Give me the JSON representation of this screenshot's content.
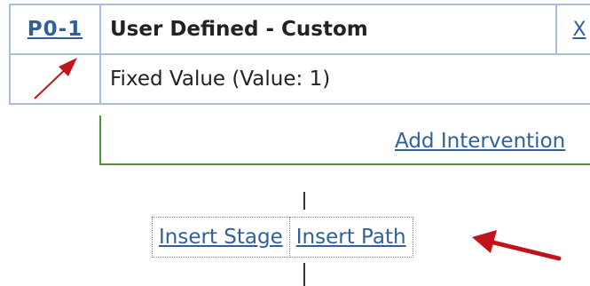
{
  "intervention": {
    "code": "P0-1",
    "name": "User Defined - Custom",
    "close_label": "X",
    "description": "Fixed Value (Value: 1)",
    "trend_icon": "arrow-up-right-icon"
  },
  "path": {
    "add_intervention_label": "Add Intervention"
  },
  "inserts": {
    "insert_stage_label": "Insert Stage",
    "insert_path_label": "Insert Path"
  },
  "annotation": {
    "pointer_icon": "arrow-left-icon",
    "color": "#c0141c"
  },
  "colors": {
    "link": "#30609a",
    "table_border": "#a9bede",
    "path_border": "#4a9a3a"
  }
}
